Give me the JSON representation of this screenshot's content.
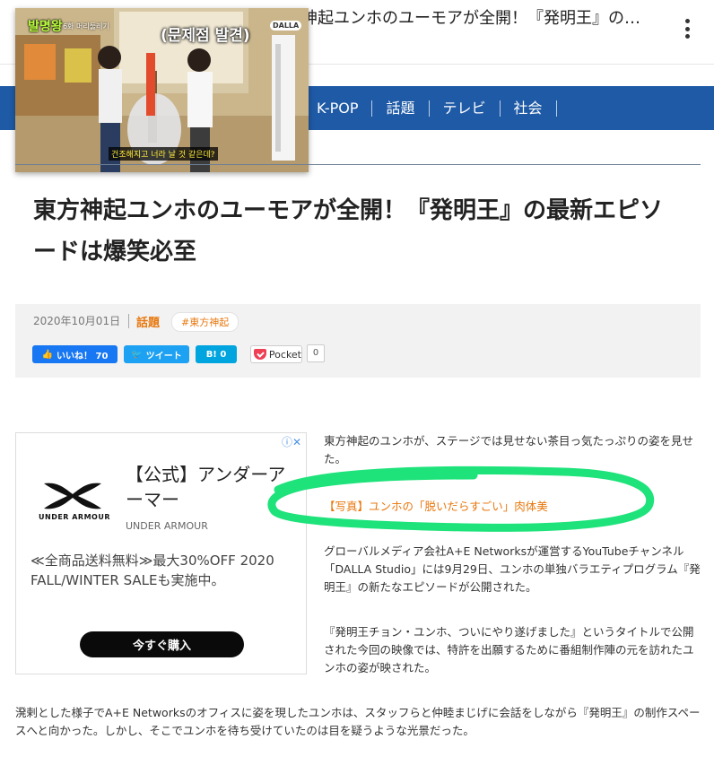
{
  "header": {
    "title": "東方神起ユンホのユーモアが全開！『発明王』の最新エピソードは爆笑必至",
    "menu_icon": "kebab-menu-icon"
  },
  "nav": {
    "items": [
      "K-POP",
      "話題",
      "テレビ",
      "社会"
    ]
  },
  "video": {
    "caption": "(문제점 발견)",
    "logo": "발명왕",
    "logo_sub": "6화 머리둘레기",
    "subtitle": "건조해지고 너라 날 것 같은데?",
    "brand": "DALLA"
  },
  "article": {
    "headline": "東方神起ユンホのユーモアが全開！『発明王』の最新エピソードは爆笑必至",
    "date": "2020年10月01日",
    "category": "話題",
    "tag": "#東方神起",
    "p1": "東方神起のユンホが、ステージでは見せない茶目っ気たっぷりの姿を見せた。",
    "photo_link": "【写真】ユンホの「脱いだらすごい」肉体美",
    "p2": "グローバルメディア会社A+E Networksが運営するYouTubeチャンネル「DALLA Studio」には9月29日、ユンホの単独バラエティプログラム『発明王』の新たなエピソードが公開された。",
    "p3": "『発明王チョン・ユンホ、ついにやり遂げました』というタイトルで公開された今回の映像では、特許を出願するために番組制作陣の元を訪れたユンホの姿が映された。",
    "p4": "溌剌とした様子でA+E Networksのオフィスに姿を現したユンホは、スタッフらと仲睦まじげに会話をしながら『発明王』の制作スペースへと向かった。しかし、そこでユンホを待ち受けていたのは目を疑うような光景だった。"
  },
  "share": {
    "facebook_label": "いいね！ 70",
    "twitter_label": "ツイート",
    "hatena_label": "B! 0",
    "pocket_label": "Pocket",
    "pocket_count": "0"
  },
  "ad": {
    "title": "【公式】アンダーアーマー",
    "logo_text": "UNDER ARMOUR",
    "brand": "UNDER ARMOUR",
    "body": "≪全商品送料無料≫最大30%OFF 2020 FALL/WINTER SALEも実施中。",
    "cta": "今すぐ購入",
    "choices": "ⓘ✕"
  },
  "colors": {
    "nav_bg": "#1f5aa6",
    "accent": "#e8780f",
    "annotation": "#1ee27a"
  }
}
